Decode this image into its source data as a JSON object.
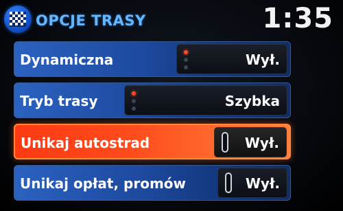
{
  "header": {
    "title": "OPCJE TRASY",
    "time": "1:35"
  },
  "rows": [
    {
      "label": "Dynamiczna",
      "value": "Wył.",
      "control": "list-indicator",
      "active_index": 0,
      "option_count": 3
    },
    {
      "label": "Tryb trasy",
      "value": "Szybka",
      "control": "list-indicator",
      "active_index": 0,
      "option_count": 3
    },
    {
      "label": "Unikaj autostrad",
      "value": "Wył.",
      "control": "toggle",
      "selected": true
    },
    {
      "label": "Unikaj opłat, promów",
      "value": "Wył.",
      "control": "toggle"
    }
  ],
  "colors": {
    "title": "#63b6ff",
    "row_blue": "#1e4aa0",
    "row_selected": "#ff4a1c",
    "indicator_on": "#ff4a2a"
  },
  "icons": {
    "nav": "checkered-flag-icon"
  }
}
